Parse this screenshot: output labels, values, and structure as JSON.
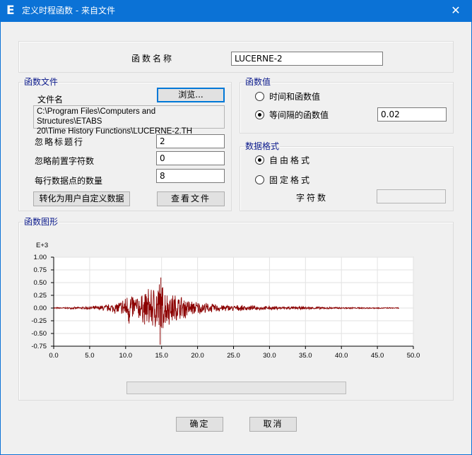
{
  "window": {
    "title": "定义时程函数 - 来自文件",
    "app_icon_glyph": "E",
    "close_glyph": "✕"
  },
  "function_name": {
    "label": "函数名称",
    "value": "LUCERNE-2"
  },
  "function_file": {
    "legend": "函数文件",
    "file_name_label": "文件名",
    "browse_button": "浏览...",
    "path_line1": "C:\\Program Files\\Computers and Structures\\ETABS",
    "path_line2": "20\\Time History Functions\\LUCERNE-2.TH",
    "skip_header_label": "忽略标题行",
    "skip_header_value": "2",
    "skip_prefix_label": "忽略前置字符数",
    "skip_prefix_value": "0",
    "points_per_line_label": "每行数据点的数量",
    "points_per_line_value": "8",
    "convert_button": "转化为用户自定义数据",
    "view_file_button": "查看文件"
  },
  "values": {
    "legend": "函数值",
    "option_time_value": "时间和函数值",
    "option_equal_interval": "等间隔的函数值",
    "selected": "equal_interval",
    "interval_value": "0.02"
  },
  "format": {
    "legend": "数据格式",
    "option_free": "自由格式",
    "option_fixed": "固定格式",
    "selected": "free",
    "char_count_label": "字符数",
    "char_count_value": ""
  },
  "graph": {
    "legend": "函数图形"
  },
  "buttons": {
    "ok": "确定",
    "cancel": "取消"
  },
  "chart_data": {
    "type": "line",
    "title": "",
    "xlabel": "",
    "ylabel": "",
    "y_multiplier_label": "E+3",
    "xlim": [
      0,
      50
    ],
    "ylim": [
      -0.75,
      1.0
    ],
    "x_ticks": [
      "0.0",
      "5.0",
      "10.0",
      "15.0",
      "20.0",
      "25.0",
      "30.0",
      "35.0",
      "40.0",
      "45.0",
      "50.0"
    ],
    "y_ticks": [
      "1.00",
      "0.75",
      "0.50",
      "0.25",
      "0.00",
      "-0.25",
      "-0.50",
      "-0.75"
    ],
    "grid": true,
    "line_color": "#8b0000",
    "series": [
      {
        "x": [
          0,
          2,
          4,
          6,
          8,
          9,
          10,
          10.5,
          11,
          12,
          13,
          14,
          14.5,
          15,
          15.5,
          16,
          17,
          18,
          19,
          20,
          22,
          24,
          26,
          28,
          30,
          32,
          35,
          38,
          40,
          43,
          45,
          48
        ],
        "envelope": [
          0.01,
          0.015,
          0.025,
          0.04,
          0.08,
          0.12,
          0.22,
          0.35,
          0.26,
          0.22,
          0.35,
          0.42,
          0.58,
          0.45,
          0.38,
          0.3,
          0.26,
          0.22,
          0.15,
          0.12,
          0.08,
          0.06,
          0.05,
          0.04,
          0.035,
          0.03,
          0.025,
          0.02,
          0.015,
          0.012,
          0.01,
          0.008
        ],
        "min_value": -0.72,
        "max_value": 0.6
      }
    ]
  }
}
